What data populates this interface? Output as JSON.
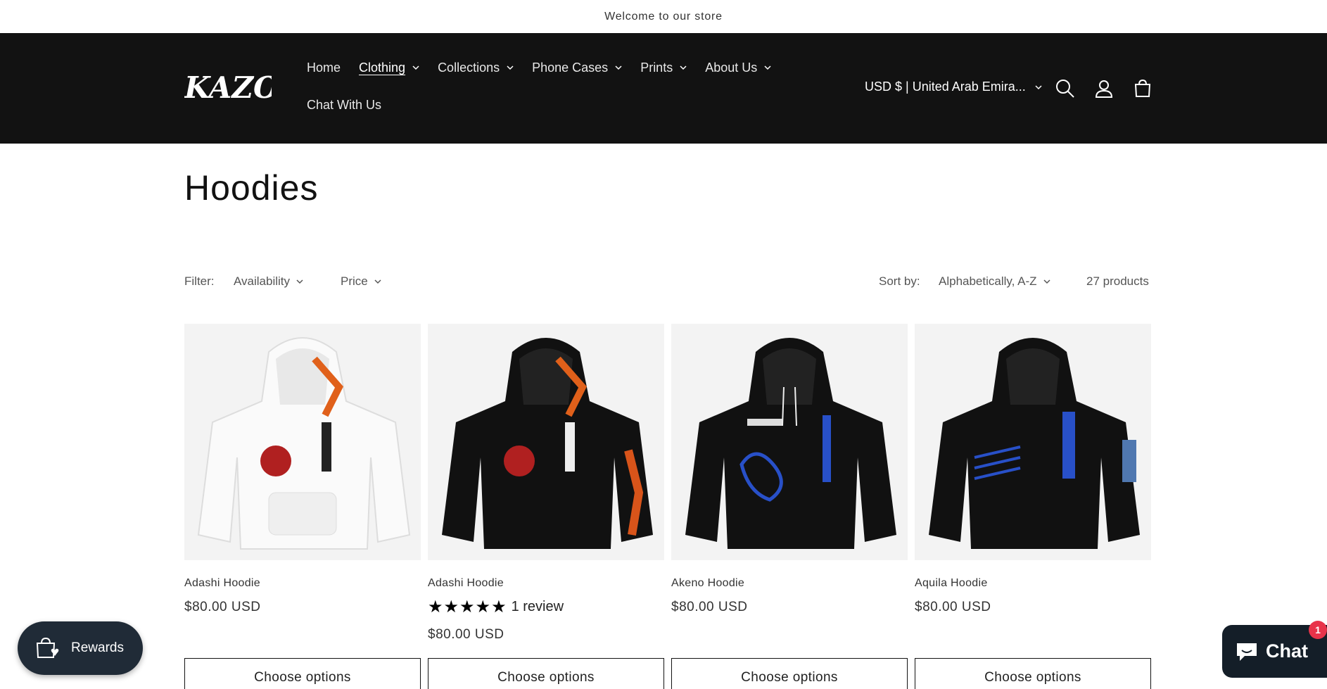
{
  "announcement": "Welcome to our store",
  "brand": {
    "logo_text": "KAZOHA"
  },
  "nav": {
    "items": [
      {
        "label": "Home",
        "dropdown": false,
        "active": false
      },
      {
        "label": "Clothing",
        "dropdown": true,
        "active": true
      },
      {
        "label": "Collections",
        "dropdown": true,
        "active": false
      },
      {
        "label": "Phone Cases",
        "dropdown": true,
        "active": false
      },
      {
        "label": "Prints",
        "dropdown": true,
        "active": false
      },
      {
        "label": "About Us",
        "dropdown": true,
        "active": false
      }
    ],
    "second_row": {
      "label": "Chat With Us"
    }
  },
  "header": {
    "currency": "USD $ | United Arab Emira..."
  },
  "page": {
    "title": "Hoodies"
  },
  "filters": {
    "filter_label": "Filter:",
    "availability": "Availability",
    "price": "Price",
    "sort_label": "Sort by:",
    "sort_value": "Alphabetically, A-Z",
    "count": "27 products"
  },
  "products": [
    {
      "name": "Adashi Hoodie",
      "price": "$80.00 USD",
      "button": "Choose options",
      "color": "white"
    },
    {
      "name": "Adashi Hoodie",
      "price": "$80.00 USD",
      "button": "Choose options",
      "color": "black",
      "rating": {
        "stars": 5,
        "label": "1 review"
      }
    },
    {
      "name": "Akeno Hoodie",
      "price": "$80.00 USD",
      "button": "Choose options",
      "color": "black"
    },
    {
      "name": "Aquila Hoodie",
      "price": "$80.00 USD",
      "button": "Choose options",
      "color": "black"
    }
  ],
  "rewards": {
    "label": "Rewards"
  },
  "chat": {
    "label": "Chat",
    "badge": "1"
  },
  "colors": {
    "header_bg": "#121212",
    "chat_bg": "#141e28",
    "rewards_bg": "#202b37",
    "badge": "#e8334a"
  }
}
